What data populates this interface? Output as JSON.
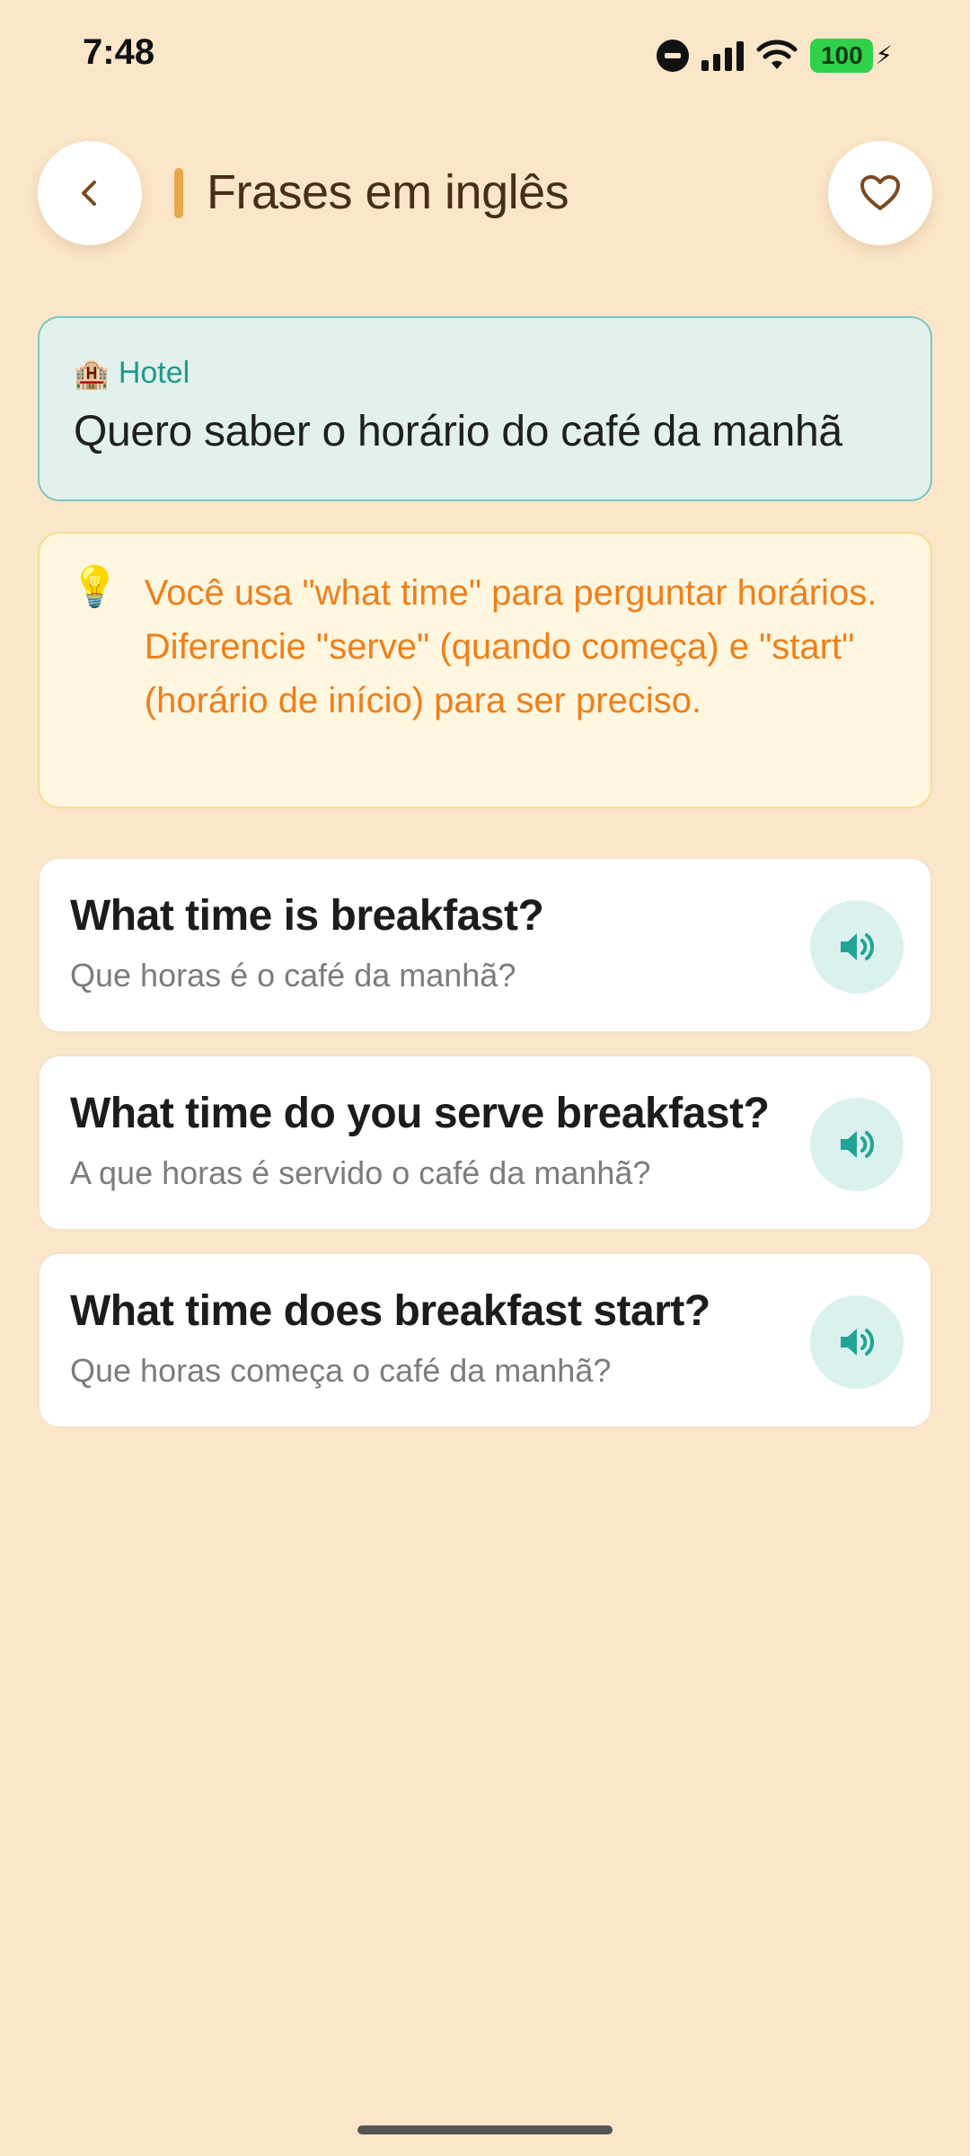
{
  "status_bar": {
    "time": "7:48",
    "battery": "100",
    "icons": [
      "do-not-disturb-icon",
      "signal-icon",
      "wifi-icon",
      "battery-icon",
      "charging-bolt-icon"
    ]
  },
  "header": {
    "title": "Frases em inglês",
    "back_icon": "chevron-left-icon",
    "favorite_icon": "heart-outline-icon"
  },
  "context": {
    "category_icon": "🏨",
    "category": "Hotel",
    "text": "Quero saber o horário do café da manhã"
  },
  "tip": {
    "icon": "💡",
    "text": "Você usa \"what time\" para perguntar horários. Diferencie \"serve\" (quando começa) e \"start\" (horário de início) para ser preciso."
  },
  "phrases": [
    {
      "en": "What time is breakfast?",
      "pt": "Que horas é o café da manhã?"
    },
    {
      "en": "What time do you serve breakfast?",
      "pt": "A que horas é servido o café da manhã?"
    },
    {
      "en": "What time does breakfast start?",
      "pt": "Que horas começa o café da manhã?"
    }
  ],
  "colors": {
    "background": "#fbe6c9",
    "accent": "#e9a64a",
    "teal": "#1d9a8c",
    "tip_text": "#ef7f1a"
  }
}
